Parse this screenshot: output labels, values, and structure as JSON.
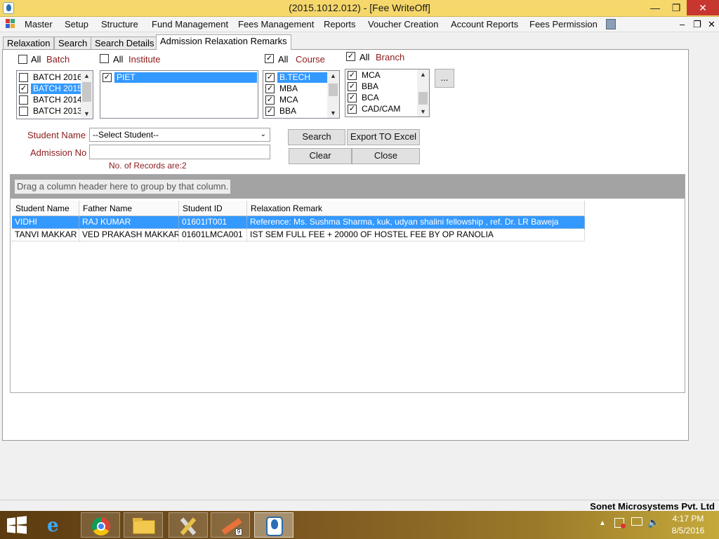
{
  "window": {
    "title": "(2015.1012.012) - [Fee WriteOff]",
    "controls": {
      "minimize": "—",
      "maximize": "❐",
      "close": "✕"
    }
  },
  "menu": {
    "items": [
      "Master",
      "Setup",
      "Structure",
      "Fund Management",
      "Fees Management",
      "Reports",
      "Voucher Creation",
      "Account Reports",
      "Fees Permission"
    ],
    "mdi_controls": {
      "minimize": "–",
      "restore": "❐",
      "close": "✕"
    }
  },
  "tabs": [
    "Relaxation",
    "Search",
    "Search Details",
    "Admission Relaxation Remarks"
  ],
  "filters": {
    "batch": {
      "all_label": "All",
      "label": "Batch",
      "all_checked": false,
      "items": [
        {
          "label": "BATCH 2016",
          "checked": false,
          "selected": false
        },
        {
          "label": "BATCH 2015",
          "checked": true,
          "selected": true
        },
        {
          "label": "BATCH 2014",
          "checked": false,
          "selected": false
        },
        {
          "label": "BATCH 2013",
          "checked": false,
          "selected": false
        }
      ]
    },
    "institute": {
      "all_label": "All",
      "label": "Institute",
      "all_checked": false,
      "items": [
        {
          "label": "PIET",
          "checked": true,
          "selected": true
        }
      ]
    },
    "course": {
      "all_label": "All",
      "label": "Course",
      "all_checked": true,
      "items": [
        {
          "label": "B.TECH",
          "checked": true,
          "selected": true
        },
        {
          "label": "MBA",
          "checked": true,
          "selected": false
        },
        {
          "label": "MCA",
          "checked": true,
          "selected": false
        },
        {
          "label": "BBA",
          "checked": true,
          "selected": false
        }
      ]
    },
    "branch": {
      "all_label": "All",
      "label": "Branch",
      "all_checked": true,
      "items": [
        {
          "label": "MCA",
          "checked": true,
          "selected": false
        },
        {
          "label": "BBA",
          "checked": true,
          "selected": false
        },
        {
          "label": "BCA",
          "checked": true,
          "selected": false
        },
        {
          "label": "CAD/CAM",
          "checked": true,
          "selected": false
        }
      ]
    },
    "more_button": "..."
  },
  "form": {
    "student_name_label": "Student Name",
    "student_select_value": "--Select Student--",
    "admission_no_label": "Admission No",
    "admission_no_value": "",
    "records_text": "No. of Records are:2"
  },
  "buttons": {
    "search": "Search",
    "export": "Export TO Excel",
    "clear": "Clear",
    "close": "Close"
  },
  "grid": {
    "group_hint": "Drag a column header here to group by that column.",
    "columns": [
      "Student Name",
      "Father Name",
      "Student ID",
      "Relaxation Remark"
    ],
    "rows": [
      [
        "VIDHI",
        "RAJ KUMAR",
        "01601IT001",
        "Reference: Ms. Sushma Sharma, kuk, udyan shalini fellowship , ref. Dr. LR Baweja"
      ],
      [
        "TANVI MAKKAR",
        "VED PRAKASH MAKKAR",
        "01601LMCA001",
        "IST SEM FULL FEE + 20000 OF HOSTEL FEE BY OP RANOLIA"
      ]
    ],
    "selected_row": 0
  },
  "status": {
    "company": "Sonet Microsystems Pvt. Ltd"
  },
  "taskbar": {
    "apps": [
      "start",
      "internet-explorer",
      "chrome",
      "file-explorer",
      "tools",
      "pencil-app",
      "fee-app"
    ],
    "time": "4:17 PM",
    "date": "8/5/2016"
  }
}
